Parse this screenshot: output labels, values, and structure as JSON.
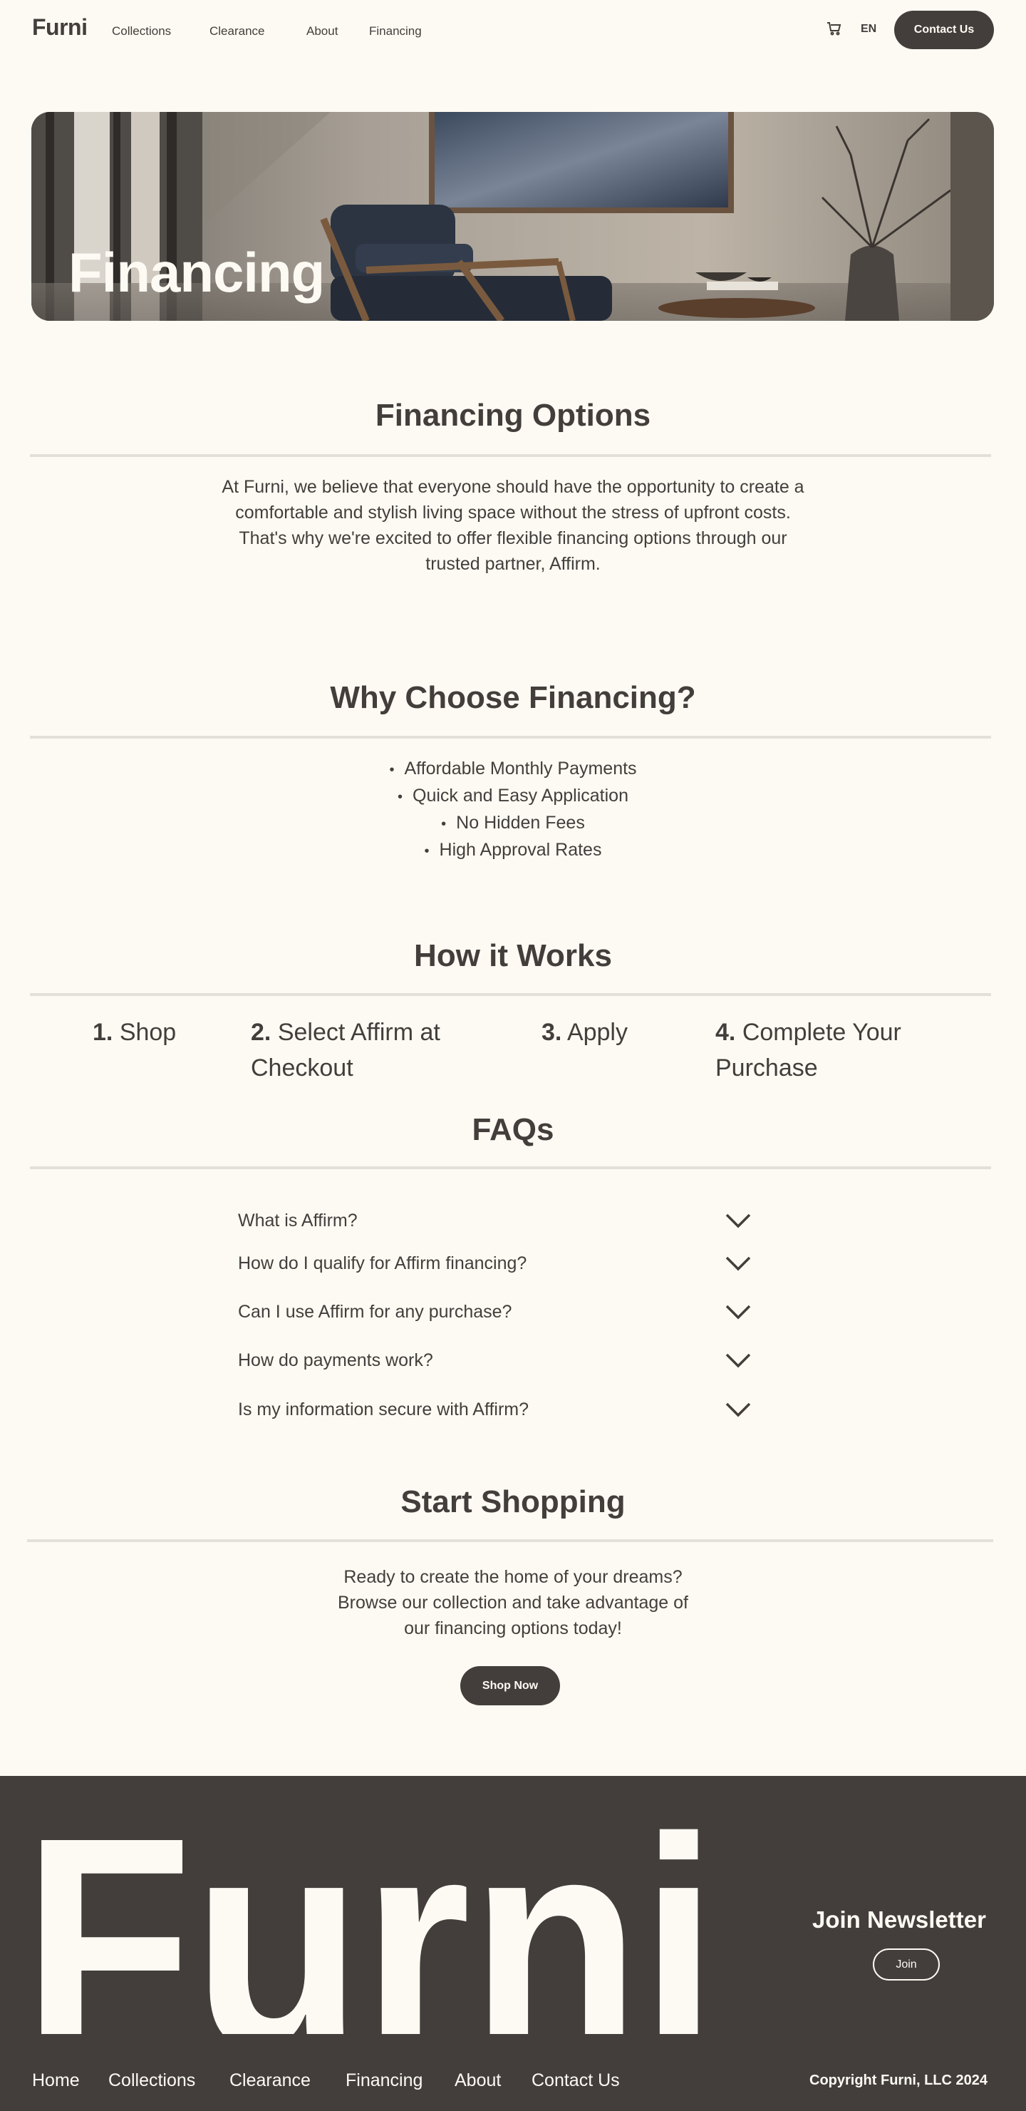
{
  "header": {
    "logo": "Furni",
    "nav": [
      "Collections",
      "Clearance",
      "About",
      "Financing"
    ],
    "cart_icon": "cart-icon",
    "lang": "EN",
    "contact_label": "Contact Us"
  },
  "hero": {
    "title": "Financing"
  },
  "options": {
    "heading": "Financing Options",
    "lines": [
      "At Furni, we believe that everyone should have the opportunity to create a",
      "comfortable and stylish living space without the stress of upfront costs.",
      "That's why we're excited to offer flexible financing options through our",
      "trusted partner, Affirm."
    ]
  },
  "why": {
    "heading": "Why Choose Financing?",
    "items": [
      "Affordable Monthly Payments",
      "Quick and Easy Application",
      "No Hidden Fees",
      "High Approval Rates"
    ]
  },
  "how": {
    "heading": "How it Works",
    "steps": [
      {
        "num": "1.",
        "text": "Shop"
      },
      {
        "num": "2.",
        "text": "Select Affirm at Checkout"
      },
      {
        "num": "3.",
        "text": "Apply"
      },
      {
        "num": "4.",
        "text": "Complete Your Purchase"
      }
    ]
  },
  "faqs": {
    "heading": "FAQs",
    "icon": "chevron-down-icon",
    "items": [
      "What is Affirm?",
      "How do I qualify for Affirm financing?",
      "Can I use Affirm for any purchase?",
      "How do payments work?",
      "Is my information secure with Affirm?"
    ]
  },
  "start": {
    "heading": "Start Shopping",
    "lines": [
      "Ready to create the home of your dreams?",
      "Browse our collection and take advantage of",
      "our financing options today!"
    ],
    "button": "Shop Now"
  },
  "footer": {
    "brand": "Furni",
    "newsletter_title": "Join Newsletter",
    "join_label": "Join",
    "links": [
      "Home",
      "Collections",
      "Clearance",
      "Financing",
      "About",
      "Contact Us"
    ],
    "copyright": "Copyright Furni, LLC 2024"
  },
  "colors": {
    "background": "#fdfaf3",
    "text": "#433e3b",
    "footer": "#433e3b",
    "rule": "#e3e0da"
  }
}
